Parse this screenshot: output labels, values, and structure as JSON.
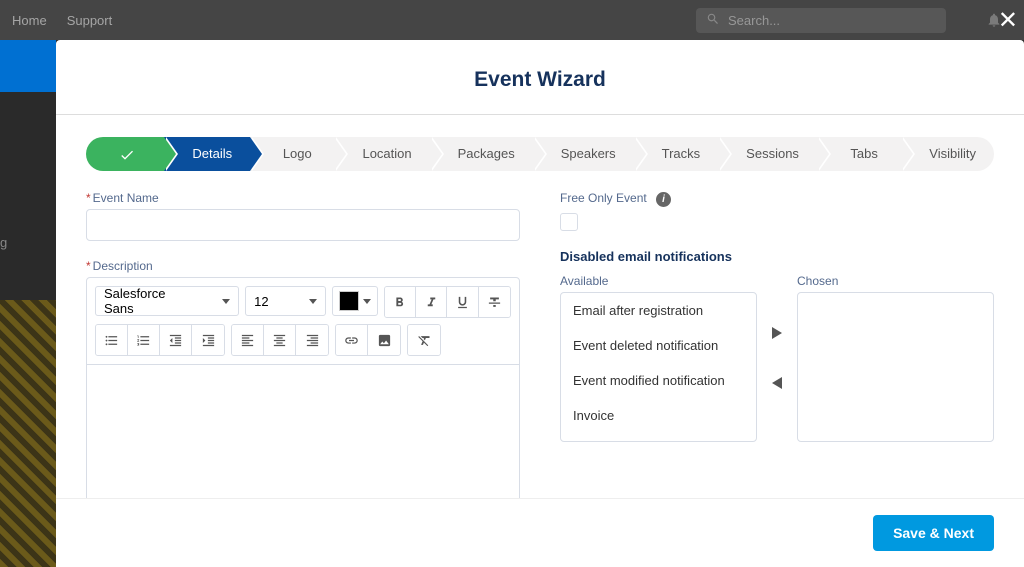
{
  "topbar": {
    "home": "Home",
    "support": "Support",
    "search_placeholder": "Search..."
  },
  "modal": {
    "title": "Event Wizard",
    "save_next": "Save & Next"
  },
  "steps": [
    {
      "label": "",
      "state": "done"
    },
    {
      "label": "Details",
      "state": "active"
    },
    {
      "label": "Logo",
      "state": ""
    },
    {
      "label": "Location",
      "state": ""
    },
    {
      "label": "Packages",
      "state": ""
    },
    {
      "label": "Speakers",
      "state": ""
    },
    {
      "label": "Tracks",
      "state": ""
    },
    {
      "label": "Sessions",
      "state": ""
    },
    {
      "label": "Tabs",
      "state": ""
    },
    {
      "label": "Visibility",
      "state": ""
    }
  ],
  "form": {
    "event_name_label": "Event Name",
    "description_label": "Description",
    "free_only_label": "Free Only Event",
    "disabled_notifications_heading": "Disabled email notifications",
    "available_label": "Available",
    "chosen_label": "Chosen"
  },
  "editor": {
    "font_family": "Salesforce Sans",
    "font_size": "12"
  },
  "available_items": [
    "Email after registration",
    "Event deleted notification",
    "Event modified notification",
    "Invoice"
  ],
  "bg_text": "g"
}
